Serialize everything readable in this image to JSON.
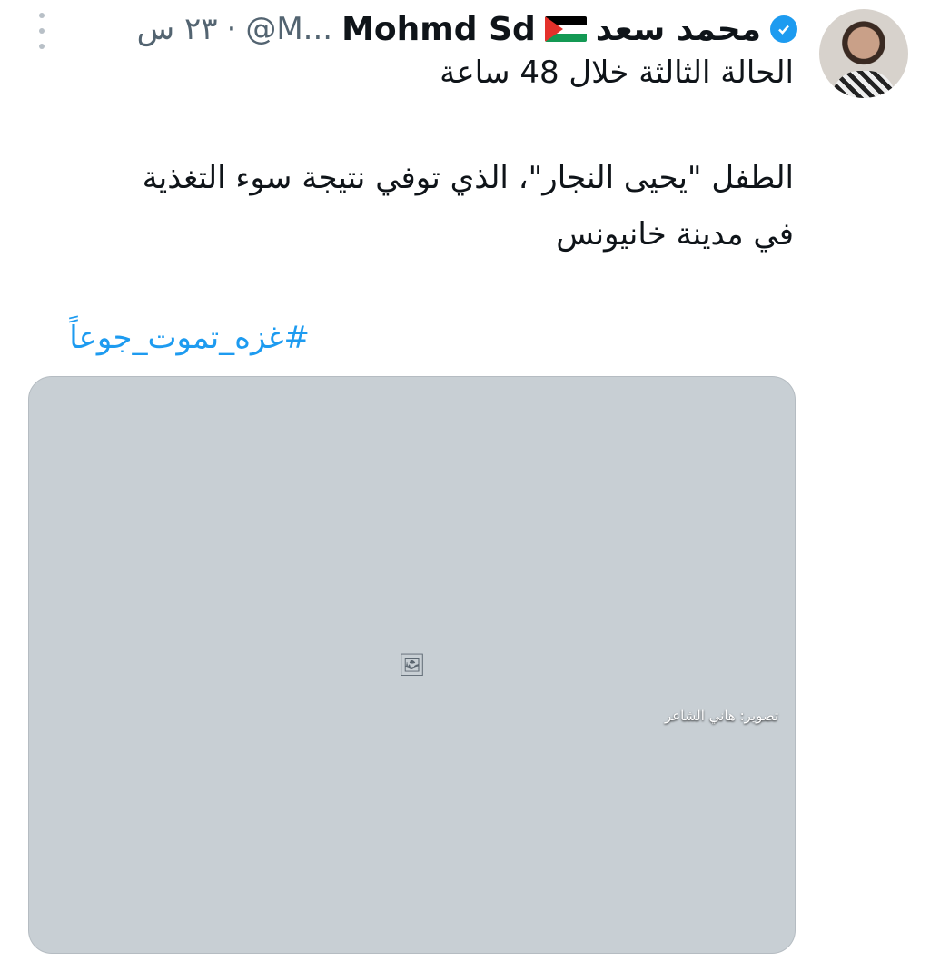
{
  "tweet": {
    "display_name": "محمد سعد",
    "display_name_latin": "Mohmd Sd",
    "handle": "@M...",
    "time": "٢٣ س",
    "separator": "·",
    "text_lines": [
      "الحالة الثالثة خلال 48 ساعة",
      "الطفل \"يحيى النجار\"، الذي توفي نتيجة سوء التغذية",
      "في مدينة خانيونس"
    ],
    "hashtag": "#غزه_تموت_جوعاً",
    "media": {
      "credit": "تصوير: هاني الشاعر"
    }
  },
  "icons": {
    "verified": "verified-badge-icon",
    "flag": "palestine-flag-icon",
    "more": "more-options-icon"
  },
  "colors": {
    "accent": "#1d9bf0",
    "secondary_text": "#536471",
    "flag_red": "#e4312b",
    "flag_green": "#149954",
    "flag_black": "#000000"
  }
}
